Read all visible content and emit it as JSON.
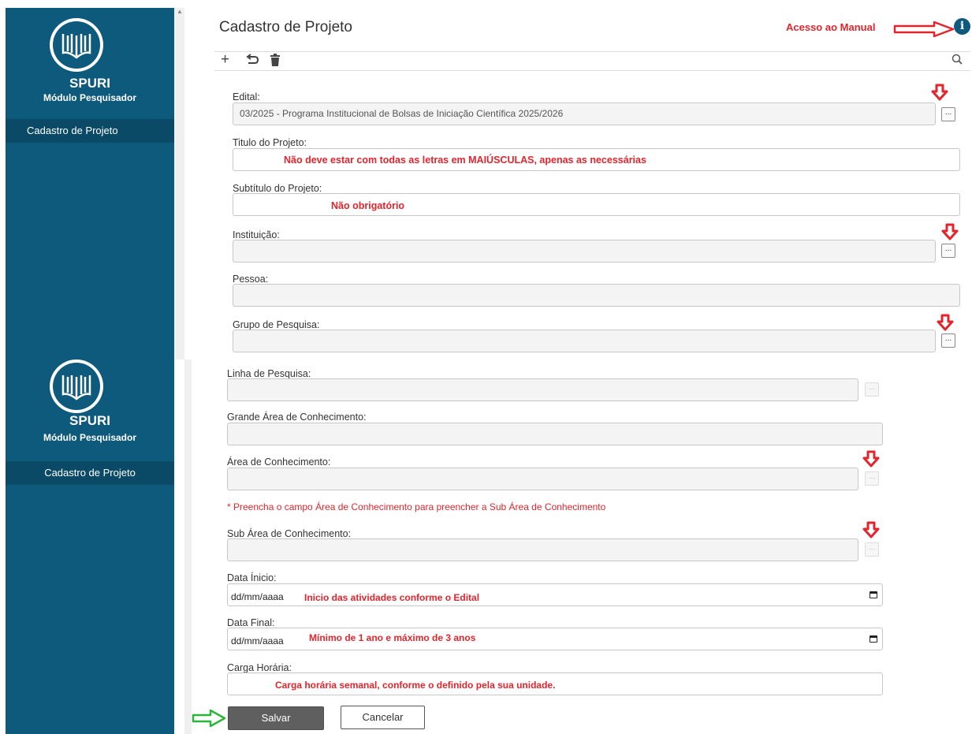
{
  "app": {
    "name": "SPURI",
    "module": "Módulo Pesquisador"
  },
  "sidebar": {
    "items": [
      {
        "label": "Cadastro de Projeto"
      }
    ]
  },
  "header": {
    "title": "Cadastro de Projeto",
    "manual_link": "Acesso ao Manual",
    "info_icon": "i"
  },
  "toolbar": {
    "icons": [
      "plus-icon",
      "undo-icon",
      "trash-icon",
      "search-icon"
    ]
  },
  "form": {
    "edital": {
      "label": "Edital:",
      "value": "03/2025 - Programa Institucional de Bolsas de Iniciação Científica 2025/2026",
      "lookup": "..."
    },
    "titulo": {
      "label": "Titulo do Projeto:",
      "value": "",
      "hint": "Não deve estar com todas as letras em MAIÚSCULAS, apenas as necessárias"
    },
    "subtitulo": {
      "label": "Subtítulo do Projeto:",
      "value": "",
      "hint": "Não obrigatório"
    },
    "instituicao": {
      "label": "Instituição:",
      "value": "",
      "lookup": "..."
    },
    "pessoa": {
      "label": "Pessoa:",
      "value": ""
    },
    "grupo": {
      "label": "Grupo de Pesquisa:",
      "value": "",
      "lookup": "..."
    },
    "linha": {
      "label": "Linha de Pesquisa:",
      "value": "",
      "lookup": "..."
    },
    "grande_area": {
      "label": "Grande Área de Conhecimento:",
      "value": ""
    },
    "area": {
      "label": "Área de Conhecimento:",
      "value": "",
      "lookup": "..."
    },
    "area_note": "* Preencha o campo Área de Conhecimento para preencher a Sub Área de Conhecimento",
    "sub_area": {
      "label": "Sub Área de Conhecimento:",
      "value": "",
      "lookup": "..."
    },
    "data_inicio": {
      "label": "Data Ínicio:",
      "placeholder": "dd/mm/aaaa",
      "hint": "Inicio das atividades conforme o Edital"
    },
    "data_final": {
      "label": "Data Final:",
      "placeholder": "dd/mm/aaaa",
      "hint": "Mínimo de 1 ano e máximo de 3 anos"
    },
    "carga": {
      "label": "Carga Horária:",
      "value": "",
      "hint": "Carga horária semanal, conforme o definido pela sua unidade."
    }
  },
  "actions": {
    "save": "Salvar",
    "cancel": "Cancelar"
  },
  "colors": {
    "sidebar": "#0d5a7d",
    "annotation": "#e2252c",
    "save_arrow": "#2db53a",
    "save_button": "#5f5f5f"
  }
}
